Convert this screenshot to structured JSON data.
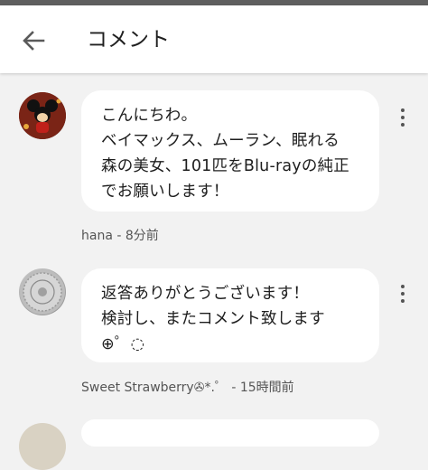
{
  "header": {
    "title": "コメント",
    "back_icon": "arrow-left-icon"
  },
  "comments": [
    {
      "author": "hana",
      "time": "8分前",
      "meta": "hana - 8分前",
      "text": "こんにちわ。\nベイマックス、ムーラン、眠れる\n森の美女、101匹をBlu-rayの純正\nでお願いします！",
      "avatar": "mickey-mouse-avatar"
    },
    {
      "author": "Sweet Strawberry",
      "time": "15時間前",
      "meta": "Sweet Strawberry✇*.゜ - 15時間前",
      "text": "返答ありがとうございます！\n検討し、またコメント致します\n⊕゜◌",
      "avatar": "coin-avatar"
    }
  ],
  "colors": {
    "background": "#f2f2f2",
    "bubble": "#ffffff",
    "header": "#ffffff",
    "meta_text": "#555555"
  }
}
